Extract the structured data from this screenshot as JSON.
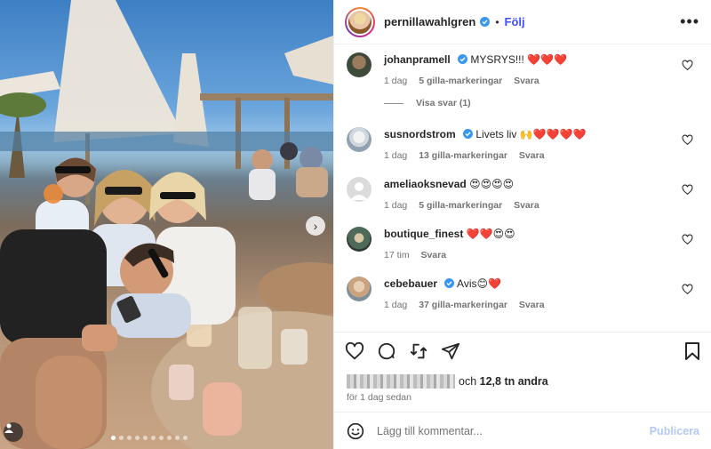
{
  "post": {
    "username": "pernillawahlgren",
    "follow_label": "Följ",
    "separator": "•"
  },
  "comments": [
    {
      "username": "johanpramell",
      "verified": true,
      "text": "MYSRYS!!! ❤️❤️❤️",
      "age": "1 dag",
      "likes": "5 gilla-markeringar",
      "reply": "Svara",
      "view_replies": "Visa svar (1)"
    },
    {
      "username": "susnordstrom",
      "verified": true,
      "text": "Livets liv 🙌❤️❤️❤️❤️",
      "age": "1 dag",
      "likes": "13 gilla-markeringar",
      "reply": "Svara"
    },
    {
      "username": "ameliaoksnevad",
      "verified": false,
      "text": "😍😍😍😍",
      "age": "1 dag",
      "likes": "5 gilla-markeringar",
      "reply": "Svara"
    },
    {
      "username": "boutique_finest",
      "verified": false,
      "text": "❤️❤️😍😍",
      "age": "17 tim",
      "likes": "",
      "reply": "Svara"
    },
    {
      "username": "cebebauer",
      "verified": true,
      "text": "Avis😊❤️",
      "age": "1 dag",
      "likes": "37 gilla-markeringar",
      "reply": "Svara"
    }
  ],
  "likes_summary": {
    "prefix": "och",
    "count": "12,8 tn andra"
  },
  "posted": "för 1 dag sedan",
  "composer": {
    "placeholder": "Lägg till kommentar...",
    "publish": "Publicera"
  },
  "carousel": {
    "total": 10,
    "active": 1
  },
  "icons": [
    "heart-icon",
    "comment-icon",
    "share-icon",
    "send-icon",
    "bookmark-icon",
    "emoji-icon",
    "more-icon",
    "chevron-right-icon",
    "user-tag-icon"
  ],
  "colors": {
    "accent": "#4150f7",
    "verified": "#3897f0",
    "publish_disabled": "#b3c9f5"
  }
}
